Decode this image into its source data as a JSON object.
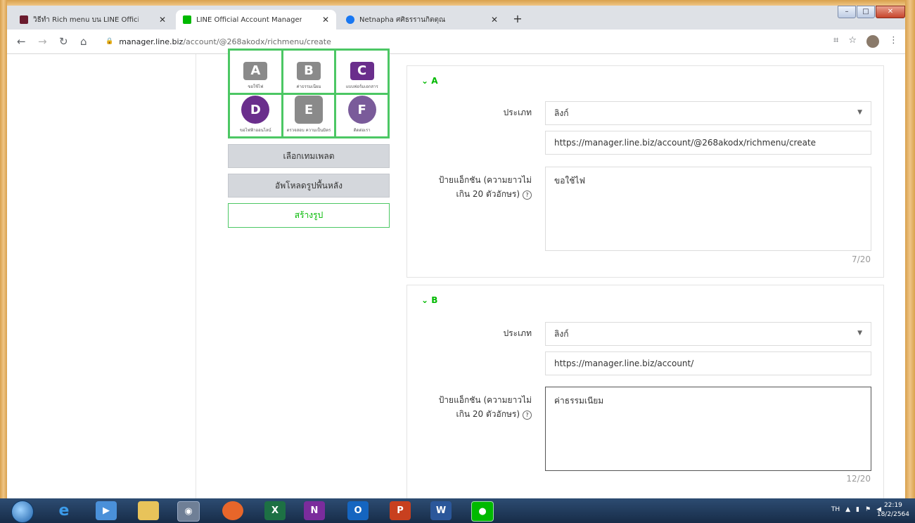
{
  "browser": {
    "tabs": [
      {
        "title": "วิธีทำ Rich menu บน LINE Official",
        "favicon_color": "#6b1b2e"
      },
      {
        "title": "LINE Official Account Manager",
        "favicon_color": "#00b900"
      },
      {
        "title": "Netnapha ศศิธรรานกิตตุณ",
        "favicon_color": "#1877f2"
      }
    ],
    "new_tab": "+",
    "url_host": "manager.line.biz",
    "url_path": "/account/@268akodx/richmenu/create"
  },
  "richmenu": {
    "cells": [
      {
        "letter": "A",
        "label": "ขอใช้ไฟ"
      },
      {
        "letter": "B",
        "label": "ค่าธรรมเนียม"
      },
      {
        "letter": "C",
        "label": "แบบฟอร์มเอกสาร"
      },
      {
        "letter": "D",
        "label": "ขอไฟฟ้าออนไลน์"
      },
      {
        "letter": "E",
        "label": "ตรวจสอบ ความเป็นมิตร"
      },
      {
        "letter": "F",
        "label": "ติดต่อเรา"
      }
    ],
    "select_template": "เลือกเทมเพลต",
    "upload_background": "อัพโหลดรูปพื้นหลัง",
    "create_image": "สร้างรูป"
  },
  "actions": [
    {
      "header": "A",
      "type_label": "ประเภท",
      "type_value": "ลิงก์",
      "url_value": "https://manager.line.biz/account/@268akodx/richmenu/create",
      "action_label_line1": "ป้ายแอ็กชัน (ความยาวไม่",
      "action_label_line2": "เกิน 20 ตัวอักษร)",
      "action_text": "ขอใช้ไฟ",
      "count": "7/20"
    },
    {
      "header": "B",
      "type_label": "ประเภท",
      "type_value": "ลิงก์",
      "url_value": "https://manager.line.biz/account/",
      "action_label_line1": "ป้ายแอ็กชัน (ความยาวไม่",
      "action_label_line2": "เกิน 20 ตัวอักษร)",
      "action_text": "ค่าธรรมเนียม",
      "count": "12/20"
    }
  ],
  "taskbar": {
    "lang": "TH",
    "time": "22:19",
    "date": "18/2/2564"
  },
  "colors": {
    "accent": "#00b900",
    "grid": "#4cc764",
    "purple": "#6a2e8c"
  }
}
